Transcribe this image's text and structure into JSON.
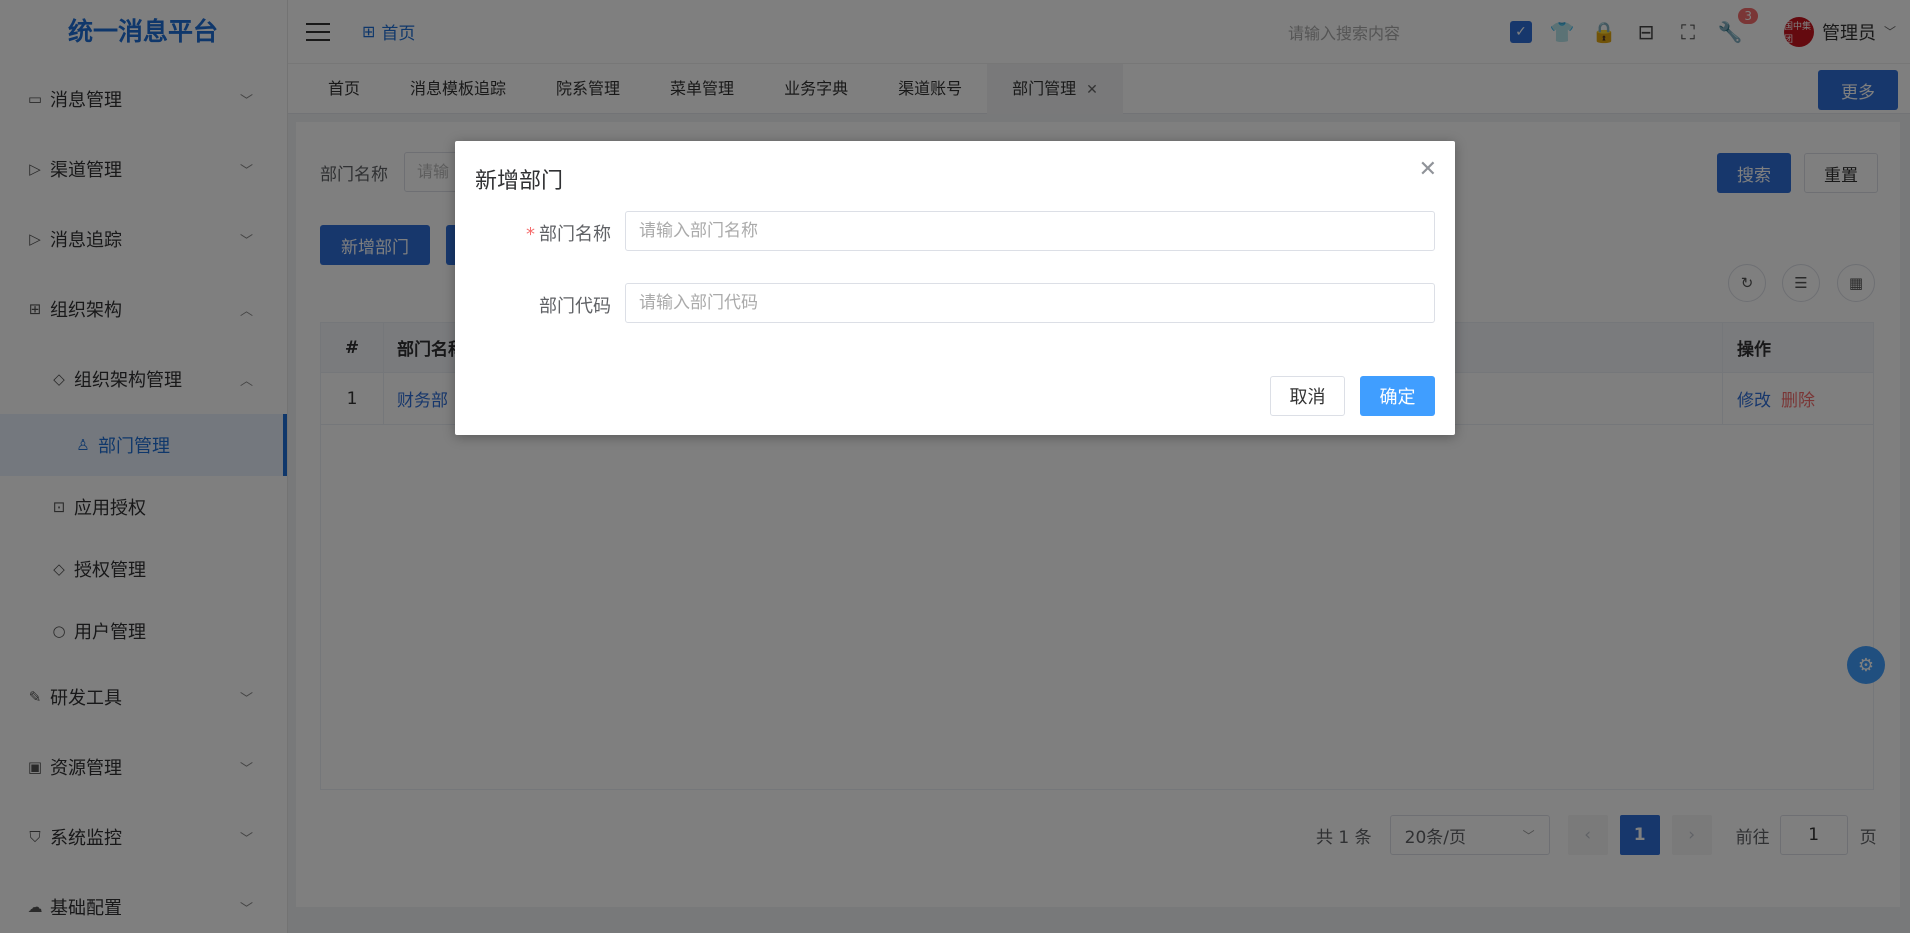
{
  "app": {
    "title": "统一消息平台"
  },
  "header": {
    "breadcrumb": "首页",
    "search_placeholder": "请输入搜索内容",
    "badge_count": "3",
    "user_name": "管理员",
    "avatar_text": "国中集团"
  },
  "sidebar": {
    "items": [
      {
        "label": "消息管理",
        "icon": "message-icon"
      },
      {
        "label": "渠道管理",
        "icon": "send-icon"
      },
      {
        "label": "消息追踪",
        "icon": "send-icon"
      },
      {
        "label": "组织架构",
        "icon": "org-icon"
      },
      {
        "label": "组织架构管理",
        "icon": "tag-icon"
      },
      {
        "label": "部门管理",
        "icon": "user-icon"
      },
      {
        "label": "应用授权",
        "icon": "app-icon"
      },
      {
        "label": "授权管理",
        "icon": "tag-icon"
      },
      {
        "label": "用户管理",
        "icon": "user-icon"
      },
      {
        "label": "研发工具",
        "icon": "tool-icon"
      },
      {
        "label": "资源管理",
        "icon": "wallet-icon"
      },
      {
        "label": "系统监控",
        "icon": "shield-icon"
      },
      {
        "label": "基础配置",
        "icon": "cloud-icon"
      }
    ]
  },
  "tabs": [
    {
      "label": "首页"
    },
    {
      "label": "消息模板追踪"
    },
    {
      "label": "院系管理"
    },
    {
      "label": "菜单管理"
    },
    {
      "label": "业务字典"
    },
    {
      "label": "渠道账号"
    },
    {
      "label": "部门管理"
    }
  ],
  "more_label": "更多",
  "filter": {
    "label": "部门名称",
    "placeholder": "请输"
  },
  "buttons": {
    "search": "搜索",
    "reset": "重置",
    "add": "新增部门"
  },
  "table": {
    "headers": {
      "num": "#",
      "name": "部门名称",
      "ops": "操作"
    },
    "rows": [
      {
        "num": "1",
        "name": "财务部",
        "edit": "修改",
        "delete": "删除"
      }
    ]
  },
  "pagination": {
    "total": "共 1 条",
    "page_size": "20条/页",
    "current": "1",
    "goto_label": "前往",
    "goto_value": "1",
    "page_unit": "页"
  },
  "dialog": {
    "title": "新增部门",
    "fields": [
      {
        "label": "部门名称",
        "required": "*",
        "placeholder": "请输入部门名称"
      },
      {
        "label": "部门代码",
        "placeholder": "请输入部门代码"
      }
    ],
    "cancel": "取消",
    "confirm": "确定"
  },
  "colors": {
    "primary": "#2f6fd8",
    "dialog_primary": "#409eff",
    "danger": "#f56c6c",
    "overlay": "rgba(0,0,0,0.5)"
  }
}
